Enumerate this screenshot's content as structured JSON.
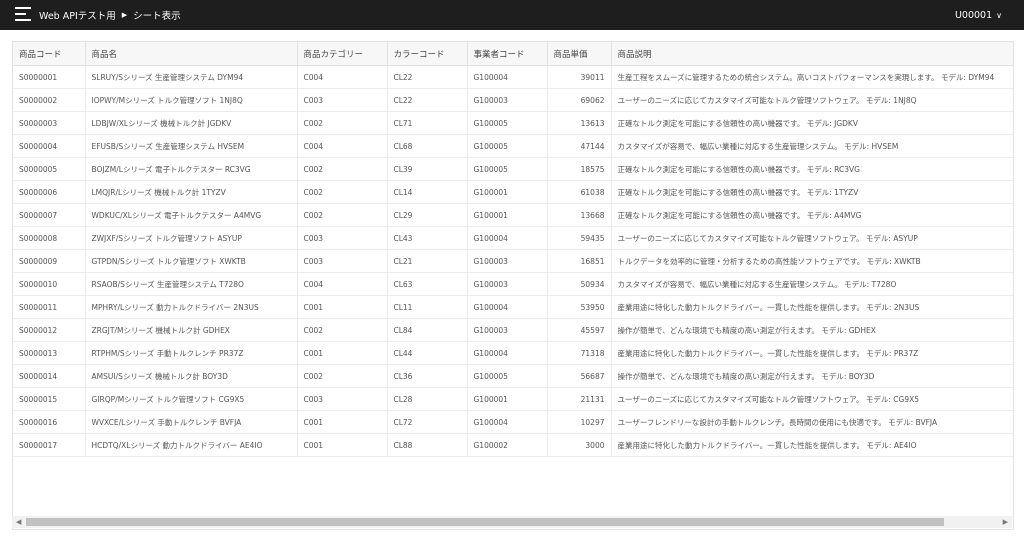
{
  "header": {
    "app_title": "Web APIテスト用",
    "separator": "▶",
    "page_title": "シート表示",
    "user": "U00001",
    "user_chevron": "∨"
  },
  "table": {
    "columns": [
      "商品コード",
      "商品名",
      "商品カテゴリー",
      "カラーコード",
      "事業者コード",
      "商品単価",
      "商品説明"
    ],
    "rows": [
      [
        "S0000001",
        "SLRUY/Sシリーズ 生産管理システム DYM94",
        "C004",
        "CL22",
        "G100004",
        "39011",
        "生産工程をスムーズに管理するための統合システム。高いコストパフォーマンスを実現します。 モデル: DYM94"
      ],
      [
        "S0000002",
        "IOPWY/Mシリーズ トルク管理ソフト 1NJ8Q",
        "C003",
        "CL22",
        "G100003",
        "69062",
        "ユーザーのニーズに応じてカスタマイズ可能なトルク管理ソフトウェア。 モデル: 1NJ8Q"
      ],
      [
        "S0000003",
        "LDBJW/XLシリーズ 機械トルク計 JGDKV",
        "C002",
        "CL71",
        "G100005",
        "13613",
        "正確なトルク測定を可能にする信頼性の高い機器です。 モデル: JGDKV"
      ],
      [
        "S0000004",
        "EFUSB/Sシリーズ 生産管理システム HVSEM",
        "C004",
        "CL68",
        "G100005",
        "47144",
        "カスタマイズが容易で、幅広い業種に対応する生産管理システム。 モデル: HVSEM"
      ],
      [
        "S0000005",
        "BOJZM/Lシリーズ 電子トルクテスター RC3VG",
        "C002",
        "CL39",
        "G100005",
        "18575",
        "正確なトルク測定を可能にする信頼性の高い機器です。 モデル: RC3VG"
      ],
      [
        "S0000006",
        "LMQJR/Lシリーズ 機械トルク計 1TYZV",
        "C002",
        "CL14",
        "G100001",
        "61038",
        "正確なトルク測定を可能にする信頼性の高い機器です。 モデル: 1TYZV"
      ],
      [
        "S0000007",
        "WDKUC/XLシリーズ 電子トルクテスター A4MVG",
        "C002",
        "CL29",
        "G100001",
        "13668",
        "正確なトルク測定を可能にする信頼性の高い機器です。 モデル: A4MVG"
      ],
      [
        "S0000008",
        "ZWJXF/Sシリーズ トルク管理ソフト ASYUP",
        "C003",
        "CL43",
        "G100004",
        "59435",
        "ユーザーのニーズに応じてカスタマイズ可能なトルク管理ソフトウェア。 モデル: ASYUP"
      ],
      [
        "S0000009",
        "GTPDN/Sシリーズ トルク管理ソフト XWKTB",
        "C003",
        "CL21",
        "G100003",
        "16851",
        "トルクデータを効率的に管理・分析するための高性能ソフトウェアです。 モデル: XWKTB"
      ],
      [
        "S0000010",
        "RSAOB/Sシリーズ 生産管理システム T728O",
        "C004",
        "CL63",
        "G100003",
        "50934",
        "カスタマイズが容易で、幅広い業種に対応する生産管理システム。 モデル: T728O"
      ],
      [
        "S0000011",
        "MPHRY/Lシリーズ 動力トルクドライバー 2N3US",
        "C001",
        "CL11",
        "G100004",
        "53950",
        "産業用途に特化した動力トルクドライバー。一貫した性能を提供します。 モデル: 2N3US"
      ],
      [
        "S0000012",
        "ZRGJT/Mシリーズ 機械トルク計 GDHEX",
        "C002",
        "CL84",
        "G100003",
        "45597",
        "操作が簡単で、どんな環境でも精度の高い測定が行えます。 モデル: GDHEX"
      ],
      [
        "S0000013",
        "RTPHM/Sシリーズ 手動トルクレンチ PR37Z",
        "C001",
        "CL44",
        "G100004",
        "71318",
        "産業用途に特化した動力トルクドライバー。一貫した性能を提供します。 モデル: PR37Z"
      ],
      [
        "S0000014",
        "AMSUI/Sシリーズ 機械トルク計 BOY3D",
        "C002",
        "CL36",
        "G100005",
        "56687",
        "操作が簡単で、どんな環境でも精度の高い測定が行えます。 モデル: BOY3D"
      ],
      [
        "S0000015",
        "GIRQP/Mシリーズ トルク管理ソフト CG9X5",
        "C003",
        "CL28",
        "G100001",
        "21131",
        "ユーザーのニーズに応じてカスタマイズ可能なトルク管理ソフトウェア。 モデル: CG9X5"
      ],
      [
        "S0000016",
        "WVXCE/Lシリーズ 手動トルクレンチ BVFJA",
        "C001",
        "CL72",
        "G100004",
        "10297",
        "ユーザーフレンドリーな設計の手動トルクレンチ。長時間の使用にも快適です。 モデル: BVFJA"
      ],
      [
        "S0000017",
        "HCDTQ/XLシリーズ 動力トルクドライバー AE4IO",
        "C001",
        "CL88",
        "G100002",
        "3000",
        "産業用途に特化した動力トルクドライバー。一貫した性能を提供します。 モデル: AE4IO"
      ]
    ]
  },
  "scrollbar": {
    "left_arrow": "◀",
    "right_arrow": "▶"
  },
  "colors": {
    "topbar": "#1e1e1e",
    "header_bg": "#f7f7f7",
    "border": "#e3e3e3"
  }
}
